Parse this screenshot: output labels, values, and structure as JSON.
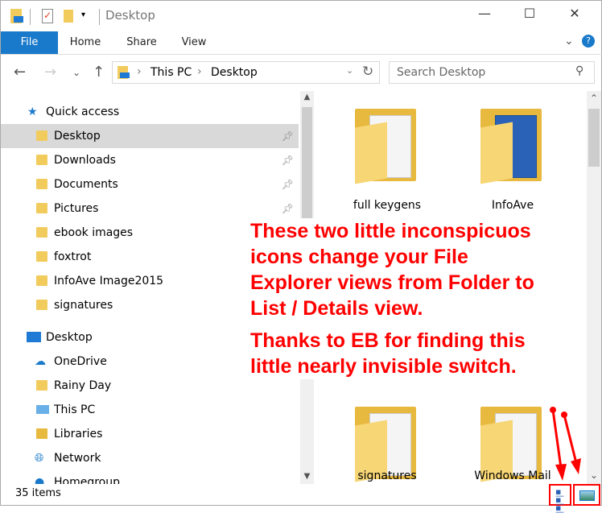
{
  "window": {
    "title": "Desktop",
    "minimize": "—",
    "maximize": "☐",
    "close": "✕"
  },
  "ribbon": {
    "tabs": [
      "File",
      "Home",
      "Share",
      "View"
    ],
    "expand": "⌄",
    "help": "?"
  },
  "address": {
    "crumbs": [
      "This PC",
      "Desktop"
    ],
    "search_placeholder": "Search Desktop"
  },
  "nav": {
    "items": [
      {
        "label": "Quick access",
        "icon": "star-icon"
      },
      {
        "label": "Desktop",
        "icon": "desktop-folder-icon",
        "pinned": true,
        "selected": true
      },
      {
        "label": "Downloads",
        "icon": "downloads-icon",
        "pinned": true
      },
      {
        "label": "Documents",
        "icon": "documents-icon",
        "pinned": true
      },
      {
        "label": "Pictures",
        "icon": "pictures-icon",
        "pinned": true
      },
      {
        "label": "ebook images",
        "icon": "folder-icon"
      },
      {
        "label": "foxtrot",
        "icon": "folder-icon"
      },
      {
        "label": "InfoAve Image2015",
        "icon": "folder-icon"
      },
      {
        "label": "signatures",
        "icon": "folder-icon"
      },
      {
        "label": "Desktop",
        "icon": "desktop-icon"
      },
      {
        "label": "OneDrive",
        "icon": "onedrive-icon"
      },
      {
        "label": "Rainy Day",
        "icon": "user-folder-icon"
      },
      {
        "label": "This PC",
        "icon": "pc-icon"
      },
      {
        "label": "Libraries",
        "icon": "libraries-icon"
      },
      {
        "label": "Network",
        "icon": "network-icon"
      },
      {
        "label": "Homegroup",
        "icon": "homegroup-icon"
      }
    ]
  },
  "content": {
    "items": [
      "full keygens",
      "InfoAve",
      "signatures",
      "Windows Mail"
    ]
  },
  "annotation": {
    "lines": [
      "These two little inconspicuos",
      "icons change your File",
      "Explorer views from Folder to",
      "List / Details view.",
      "Thanks to EB for finding this",
      "little nearly invisible switch."
    ],
    "color": "#ff0000"
  },
  "status": {
    "count": "35 items"
  }
}
